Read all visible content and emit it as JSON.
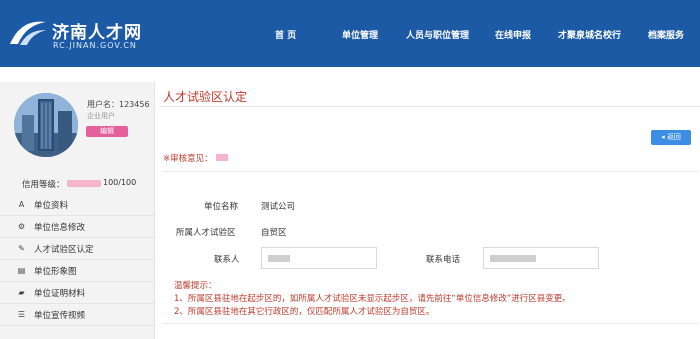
{
  "header": {
    "logo_title": "济南人才网",
    "logo_sub": "RC.JINAN.GOV.CN",
    "nav": [
      "首 页",
      "单位管理",
      "人员与职位管理",
      "在线申报",
      "才聚泉城名校行",
      "档案服务"
    ]
  },
  "profile": {
    "username_label": "用户名：123456",
    "user_type": "企业用户",
    "edit_label": "编辑",
    "credit_label": "信用等级：",
    "credit_value": "100/100"
  },
  "menu": [
    {
      "label": "单位资料",
      "icon": "A"
    },
    {
      "label": "单位信息修改",
      "icon": "⚙"
    },
    {
      "label": "人才试验区认定",
      "icon": "✎"
    },
    {
      "label": "单位形象图",
      "icon": "▤"
    },
    {
      "label": "单位证明材料",
      "icon": "▰"
    },
    {
      "label": "单位宣传视频",
      "icon": "☰"
    }
  ],
  "main": {
    "title": "人才试验区认定",
    "back_label": "◂ 返回",
    "review_label": "※审核意见：",
    "form": {
      "company_label": "单位名称",
      "company_value": "测试公司",
      "zone_label": "所属人才试验区",
      "zone_value": "自贸区",
      "contact_label": "联系人",
      "phone_label": "联系电话"
    },
    "tips": {
      "title": "温馨提示：",
      "line1": "1、所属区县驻地在起步区的，如所属人才试验区未显示起步区，请先前往“单位信息修改”进行区县变更。",
      "line2": "2、所属区县驻地在其它行政区的，仅匹配所属人才试验区为自贸区。"
    }
  },
  "colors": {
    "header_bg": "#1c5aa6",
    "accent_red": "#c0392b",
    "edit_pink": "#e3609c",
    "back_blue": "#3b8ee4"
  }
}
